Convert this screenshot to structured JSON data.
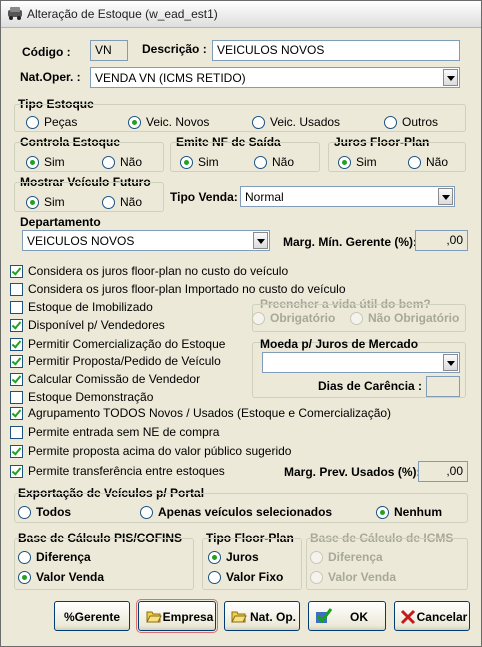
{
  "window": {
    "title": "Alteração de Estoque (w_ead_est1)"
  },
  "header": {
    "codigo_label": "Código :",
    "codigo_value": "VN",
    "descricao_label": "Descrição :",
    "descricao_value": "VEICULOS NOVOS",
    "natoper_label": "Nat.Oper. :",
    "natoper_value": "VENDA VN (ICMS RETIDO)"
  },
  "tipo_estoque": {
    "label": "Tipo Estoque",
    "options": [
      "Peças",
      "Veic. Novos",
      "Veic. Usados",
      "Outros"
    ],
    "selected": "Veic. Novos"
  },
  "controla_estoque": {
    "label": "Controla Estoque",
    "options": [
      "Sim",
      "Não"
    ],
    "selected": "Sim"
  },
  "emite_nf": {
    "label": "Emite NF de Saída",
    "options": [
      "Sim",
      "Não"
    ],
    "selected": "Sim"
  },
  "juros_fp": {
    "label": "Juros Floor-Plan",
    "options": [
      "Sim",
      "Não"
    ],
    "selected": "Sim"
  },
  "mostrar_futuro": {
    "label": "Mostrar Veículo Futuro",
    "options": [
      "Sim",
      "Não"
    ],
    "selected": "Sim"
  },
  "tipo_venda": {
    "label": "Tipo Venda:",
    "value": "Normal"
  },
  "departamento": {
    "label": "Departamento",
    "value": "VEICULOS NOVOS"
  },
  "margem": {
    "label": "Marg. Mín. Gerente (%):",
    "value": ",00"
  },
  "checks": [
    {
      "label": "Considera os juros floor-plan no custo do veículo",
      "checked": true
    },
    {
      "label": "Considera os juros floor-plan Importado no custo do veículo",
      "checked": false
    },
    {
      "label": "Estoque de Imobilizado",
      "checked": false
    },
    {
      "label": "Disponível p/ Vendedores",
      "checked": true
    },
    {
      "label": "Permitir Comercialização do Estoque",
      "checked": true
    },
    {
      "label": "Permitir Proposta/Pedido de Veículo",
      "checked": true
    },
    {
      "label": "Calcular Comissão de Vendedor",
      "checked": true
    },
    {
      "label": "Estoque Demonstração",
      "checked": false
    },
    {
      "label": "Agrupamento TODOS Novos / Usados (Estoque e Comercialização)",
      "checked": true
    },
    {
      "label": "Permite entrada sem NE de compra",
      "checked": false
    },
    {
      "label": "Permite proposta acima do valor público sugerido",
      "checked": true
    },
    {
      "label": "Permite transferência entre estoques",
      "checked": true
    }
  ],
  "vida_util": {
    "label": "Preencher a vida útil do bem?",
    "options": [
      "Obrigatório",
      "Não Obrigatório"
    ]
  },
  "moeda": {
    "label": "Moeda p/ Juros de Mercado",
    "value": ""
  },
  "dias_carencia": {
    "label": "Dias de Carência :",
    "value": ""
  },
  "marg_prev": {
    "label": "Marg. Prev. Usados (%):",
    "value": ",00"
  },
  "exportacao": {
    "label": "Exportação de Veículos p/ Portal",
    "options": [
      "Todos",
      "Apenas veículos selecionados",
      "Nenhum"
    ],
    "selected": "Nenhum"
  },
  "pis_cofins": {
    "label": "Base de Cálculo PIS/COFINS",
    "options": [
      "Diferença",
      "Valor Venda"
    ],
    "selected": "Valor Venda"
  },
  "tipo_fp": {
    "label": "Tipo Floor-Plan",
    "options": [
      "Juros",
      "Valor Fixo"
    ],
    "selected": "Juros"
  },
  "icms": {
    "label": "Base de Cálculo de ICMS",
    "options": [
      "Diferença",
      "Valor Venda"
    ]
  },
  "buttons": {
    "gerente": "%Gerente",
    "empresa": "Empresa",
    "natop": "Nat. Op.",
    "ok": "OK",
    "cancelar": "Cancelar"
  },
  "colors": {
    "accent_green": "#21a121",
    "window_bg": "#ECE9D8",
    "input_border": "#7f9db9"
  }
}
